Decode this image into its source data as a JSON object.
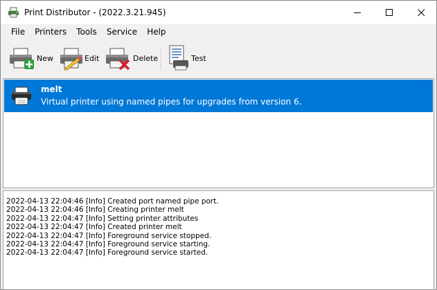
{
  "window": {
    "title": "Print Distributor - (2022.3.21.945)",
    "minimize_glyph": "—",
    "maximize_glyph": "☐",
    "close_glyph": "✕"
  },
  "menu": [
    {
      "label": "File"
    },
    {
      "label": "Printers"
    },
    {
      "label": "Tools"
    },
    {
      "label": "Service"
    },
    {
      "label": "Help"
    }
  ],
  "toolbar": {
    "new_label": "New",
    "edit_label": "Edit",
    "delete_label": "Delete",
    "test_label": "Test"
  },
  "printers": [
    {
      "name": "melt",
      "description": "Virtual printer using named pipes for upgrades from version 6.",
      "selected": true
    }
  ],
  "log": [
    "2022-04-13 22:04:46 [Info] Created port named pipe port.",
    "2022-04-13 22:04:46 [Info] Creating printer melt",
    "2022-04-13 22:04:47 [Info] Setting printer attributes",
    "2022-04-13 22:04:47 [Info] Created printer melt",
    "2022-04-13 22:04:47 [Info] Foreground service stopped.",
    "2022-04-13 22:04:47 [Info] Foreground service starting.",
    "2022-04-13 22:04:47 [Info] Foreground service started."
  ],
  "colors": {
    "selection": "#0078d7",
    "window_bg": "#f0f0f0"
  },
  "icons": {
    "app": "printer-app-icon",
    "new": "printer-add-icon",
    "edit": "printer-edit-icon",
    "delete": "printer-delete-icon",
    "test": "test-page-icon",
    "printer": "printer-icon"
  }
}
